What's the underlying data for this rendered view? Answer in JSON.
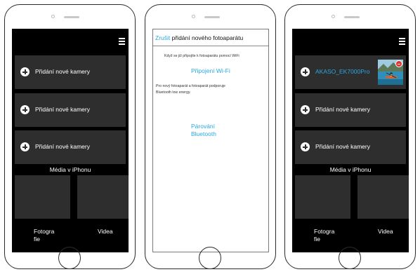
{
  "colors": {
    "accent": "#29a8e0",
    "screen_bg": "#000000",
    "row_bg": "#2e2e2e",
    "delete_badge": "#e0332e"
  },
  "phone1": {
    "menu_icon": "hamburger-icon",
    "rows": [
      {
        "icon": "plus-circle-icon",
        "label": "Přidání nové kamery"
      },
      {
        "icon": "plus-circle-icon",
        "label": "Přidání nové kamery"
      },
      {
        "icon": "plus-circle-icon",
        "label": "Přidání nové kamery"
      }
    ],
    "media_title": "Média v iPhonu",
    "tiles": {
      "photos_line1": "Fotogra",
      "photos_line2": "fie",
      "videos": "Videa"
    }
  },
  "phone2": {
    "cancel": "Zrušit",
    "title": "přidání nového fotoaparátu",
    "note1": "Když se již připojíte k fotoaparátu pomocí WiFi",
    "wifi_link": "Připojení Wi-Fi",
    "note2_line1": "Pro nový fotoaparát a fotoaparát podporuje",
    "note2_line2": "Bluetooth low energy.",
    "bt_line1": "Párování",
    "bt_line2": "Bluetooth"
  },
  "phone3": {
    "menu_icon": "hamburger-icon",
    "camera_row": {
      "icon": "plus-circle-icon",
      "label": "AKASO_EK7000Pro",
      "thumbnail": "kayak-lake-thumbnail",
      "badge": "delete-minus-icon"
    },
    "rows": [
      {
        "icon": "plus-circle-icon",
        "label": "Přidání nové kamery"
      },
      {
        "icon": "plus-circle-icon",
        "label": "Přidání nové kamery"
      }
    ],
    "media_title": "Média v iPhonu",
    "tiles": {
      "photos_line1": "Fotogra",
      "photos_line2": "fie",
      "videos": "Videa"
    }
  }
}
